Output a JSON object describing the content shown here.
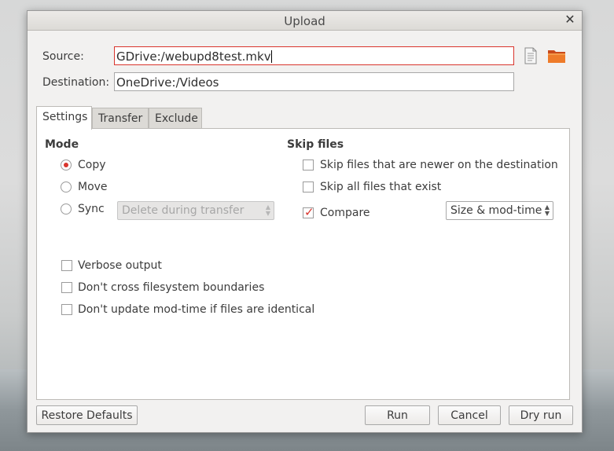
{
  "window": {
    "title": "Upload"
  },
  "source": {
    "label": "Source:",
    "value": "GDrive:/webupd8test.mkv"
  },
  "destination": {
    "label": "Destination:",
    "value": "OneDrive:/Videos"
  },
  "icons": {
    "file": "file-icon",
    "folder": "folder-icon"
  },
  "tabs": [
    {
      "label": "Settings",
      "active": true
    },
    {
      "label": "Transfer",
      "active": false
    },
    {
      "label": "Exclude",
      "active": false
    }
  ],
  "mode": {
    "title": "Mode",
    "options": [
      {
        "label": "Copy",
        "checked": true
      },
      {
        "label": "Move",
        "checked": false
      },
      {
        "label": "Sync",
        "checked": false
      }
    ],
    "sync_combo": "Delete during transfer"
  },
  "skip_files": {
    "title": "Skip files",
    "options": [
      {
        "label": "Skip files that are newer on the destination",
        "checked": false
      },
      {
        "label": "Skip all files that exist",
        "checked": false
      },
      {
        "label": "Compare",
        "checked": true
      }
    ],
    "compare_combo": "Size & mod-time"
  },
  "options": [
    {
      "label": "Verbose output",
      "checked": false
    },
    {
      "label": "Don't cross filesystem boundaries",
      "checked": false
    },
    {
      "label": "Don't update mod-time if files are identical",
      "checked": false
    }
  ],
  "buttons": {
    "restore": "Restore Defaults",
    "run": "Run",
    "cancel": "Cancel",
    "dry_run": "Dry run"
  },
  "colors": {
    "accent": "#d9352d"
  }
}
